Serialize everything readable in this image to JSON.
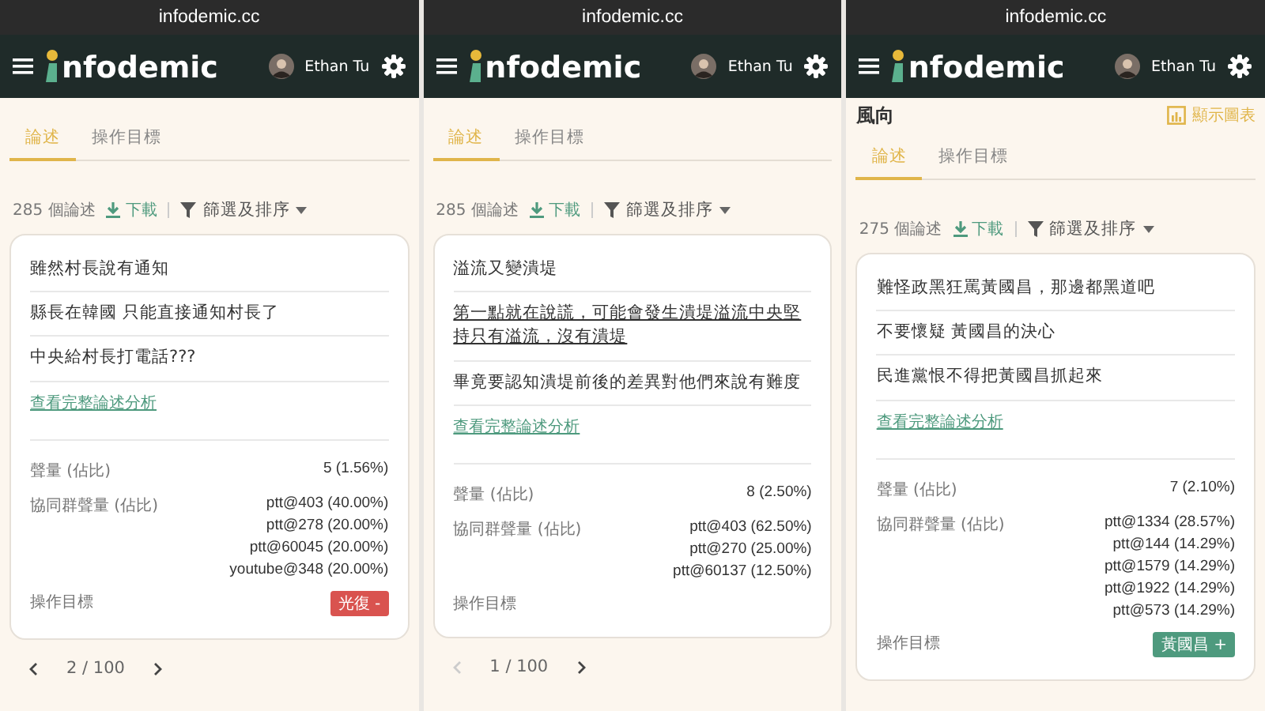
{
  "panels": [
    {
      "url": "infodemic.cc",
      "logo": "nfodemic",
      "user": "Ethan Tu",
      "tabs": [
        {
          "label": "論述",
          "selected": true
        },
        {
          "label": "操作目標",
          "selected": false
        }
      ],
      "count": "285 個論述",
      "download": "下載",
      "filter": "篩選及排序",
      "sentences": [
        {
          "text": "雖然村長說有通知",
          "underlined": false
        },
        {
          "text": "縣長在韓國 只能直接通知村長了",
          "underlined": false
        },
        {
          "text": "中央給村長打電話???",
          "underlined": false
        }
      ],
      "analysis_link": "查看完整論述分析",
      "volume_label": "聲量 (佔比)",
      "volume": "5 (1.56%)",
      "group_label": "協同群聲量 (佔比)",
      "groups": [
        "ptt@403 (40.00%)",
        "ptt@278 (20.00%)",
        "ptt@60045 (20.00%)",
        "youtube@348 (20.00%)"
      ],
      "target_label": "操作目標",
      "target_tag": {
        "label": "光復 -",
        "color": "#d9534f"
      },
      "pager": {
        "text": "2 / 100",
        "prev_disabled": false,
        "next_disabled": false
      }
    },
    {
      "url": "infodemic.cc",
      "logo": "nfodemic",
      "user": "Ethan Tu",
      "tabs": [
        {
          "label": "論述",
          "selected": true
        },
        {
          "label": "操作目標",
          "selected": false
        }
      ],
      "count": "285 個論述",
      "download": "下載",
      "filter": "篩選及排序",
      "sentences": [
        {
          "text": "溢流又變潰堤",
          "underlined": false
        },
        {
          "text": "第一點就在說謊，可能會發生潰堤溢流中央堅持只有溢流，沒有潰堤",
          "underlined": true
        },
        {
          "text": "畢竟要認知潰堤前後的差異對他們來說有難度",
          "underlined": false
        }
      ],
      "analysis_link": "查看完整論述分析",
      "volume_label": "聲量 (佔比)",
      "volume": "8 (2.50%)",
      "group_label": "協同群聲量 (佔比)",
      "groups": [
        "ptt@403 (62.50%)",
        "ptt@270 (25.00%)",
        "ptt@60137 (12.50%)"
      ],
      "target_label": "操作目標",
      "pager": {
        "text": "1 / 100",
        "prev_disabled": true,
        "next_disabled": false
      }
    },
    {
      "url": "infodemic.cc",
      "logo": "nfodemic",
      "user": "Ethan Tu",
      "heading": "風向",
      "chart_button": "顯示圖表",
      "tabs": [
        {
          "label": "論述",
          "selected": true
        },
        {
          "label": "操作目標",
          "selected": false
        }
      ],
      "count": "275 個論述",
      "download": "下載",
      "filter": "篩選及排序",
      "sentences": [
        {
          "text": "難怪政黑狂罵黃國昌，那邊都黑道吧",
          "underlined": false
        },
        {
          "text": "不要懷疑 黃國昌的決心",
          "underlined": false
        },
        {
          "text": "民進黨恨不得把黃國昌抓起來",
          "underlined": false
        }
      ],
      "analysis_link": "查看完整論述分析",
      "volume_label": "聲量 (佔比)",
      "volume": "7 (2.10%)",
      "group_label": "協同群聲量 (佔比)",
      "groups": [
        "ptt@1334 (28.57%)",
        "ptt@144 (14.29%)",
        "ptt@1579 (14.29%)",
        "ptt@1922 (14.29%)",
        "ptt@573 (14.29%)"
      ],
      "target_label": "操作目標",
      "target_tag": {
        "label": "黃國昌 +",
        "color": "#4e9a7e"
      }
    }
  ]
}
